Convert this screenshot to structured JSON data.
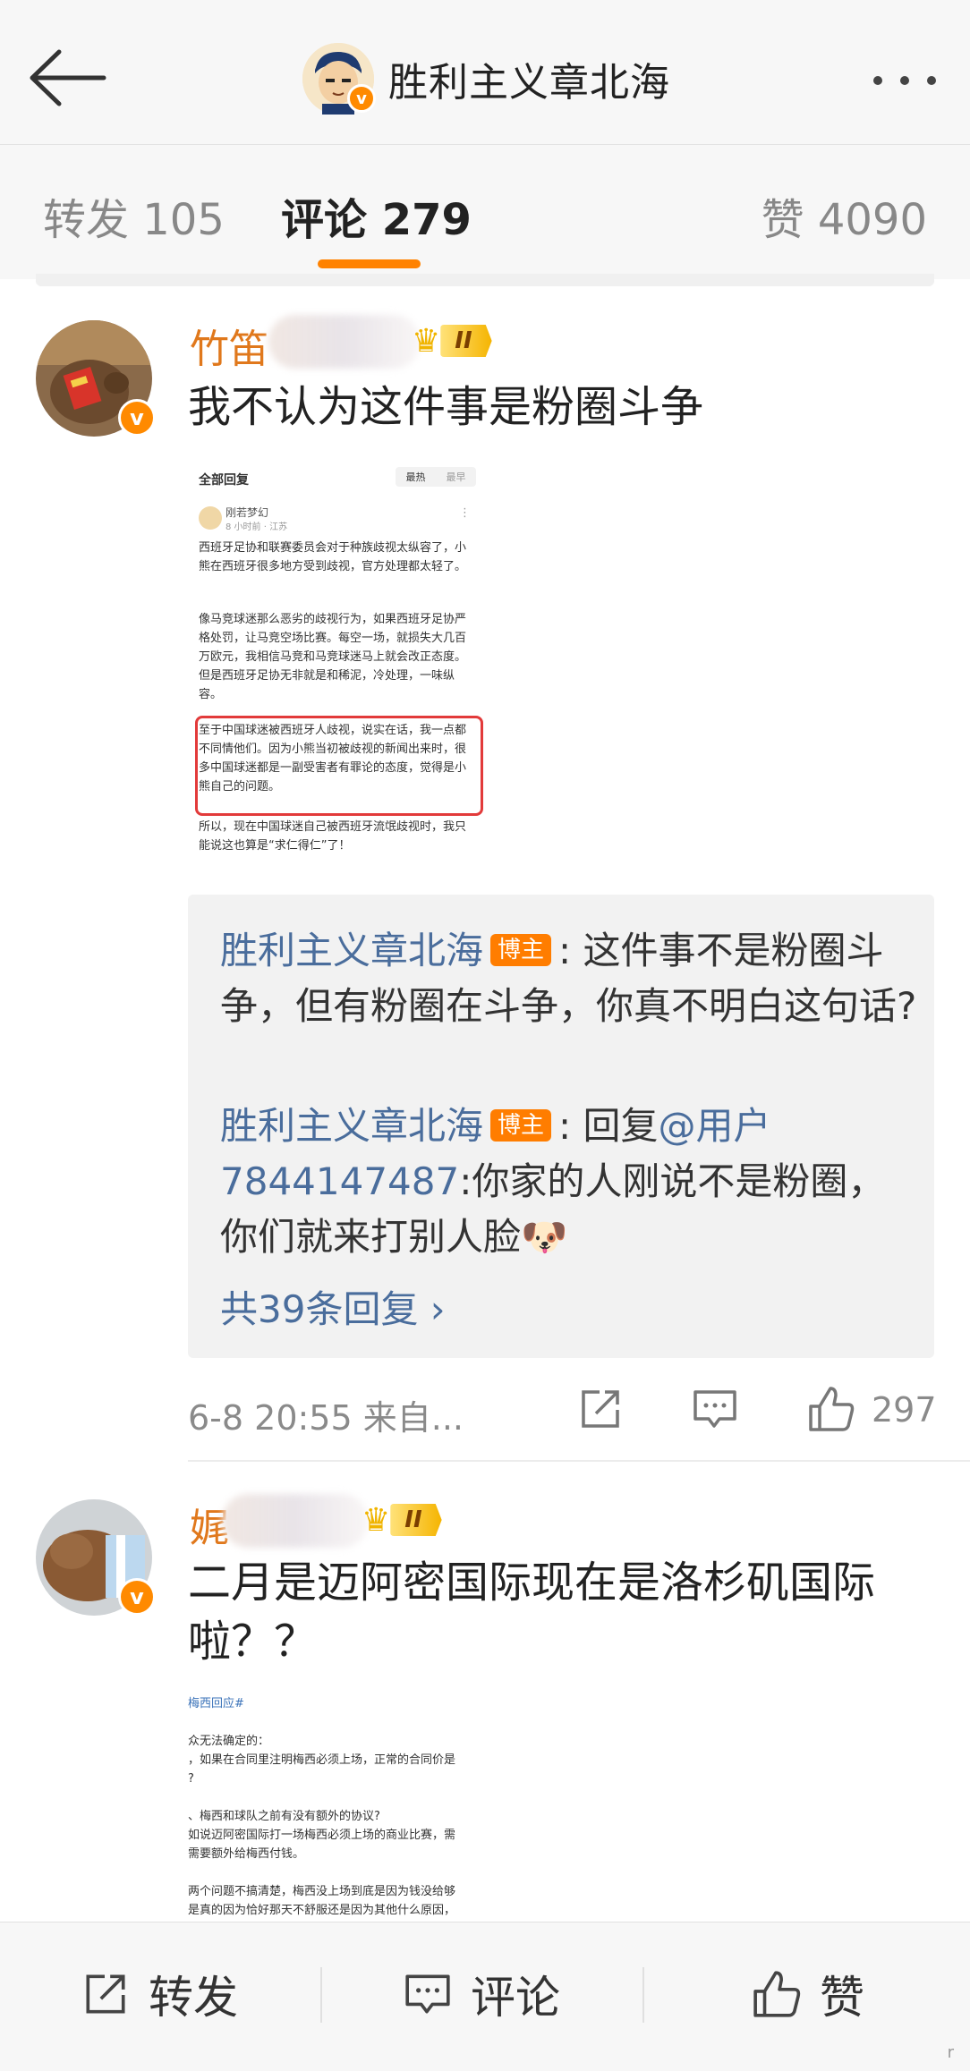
{
  "header": {
    "title": "胜利主义章北海",
    "verified": "v"
  },
  "tabs": {
    "repost": "转发 105",
    "comment": "评论 279",
    "like": "赞 4090"
  },
  "comments": [
    {
      "username": "竹笛",
      "level": "II",
      "text": "我不认为这件事是粉圈斗争",
      "screenshot": {
        "title": "全部回复",
        "tabs": [
          "最热",
          "最早"
        ],
        "user": "刚若梦幻",
        "time": "8 小时前 · 江苏",
        "para1": "西班牙足协和联赛委员会对于种族歧视太纵容了，小熊在西班牙很多地方受到歧视，官方处理都太轻了。",
        "para2": "像马竞球迷那么恶劣的歧视行为，如果西班牙足协严格处罚，让马竞空场比赛。每空一场，就损失大几百万欧元，我相信马竞和马竞球迷马上就会改正态度。但是西班牙足协无非就是和稀泥，冷处理，一味纵容。",
        "para3": "至于中国球迷被西班牙人歧视，说实在话，我一点都不同情他们。因为小熊当初被歧视的新闻出来时，很多中国球迷都是一副受害者有罪论的态度，觉得是小熊自己的问题。",
        "para4": "所以，现在中国球迷自己被西班牙流氓歧视时，我只能说这也算是“求仁得仁”了！"
      },
      "replies": [
        {
          "name": "胜利主义章北海",
          "badge": "博主",
          "text": ": 这件事不是粉圈斗争，但有粉圈在斗争，你真不明白这句话?"
        },
        {
          "name": "胜利主义章北海",
          "badge": "博主",
          "prefix": ": 回复",
          "mention": "@用户7844147487",
          "text": ":你家的人刚说不是粉圈，你们就来打别人脸",
          "emoji": "🐶"
        }
      ],
      "more_replies": "共39条回复 ›",
      "time": "6-8 20:55  来自...",
      "likes": "297"
    },
    {
      "username": "娓",
      "level": "II",
      "text": "二月是迈阿密国际现在是洛杉矶国际啦？？",
      "screenshot": {
        "hashtag": "梅西回应#",
        "l1": "众无法确定的：",
        "l2": "，如果在合同里注明梅西必须上场，正常的合同价是",
        "l3": "?",
        "l4": "、梅西和球队之前有没有额外的协议?",
        "l5": "如说迈阿密国际打一场梅西必须上场的商业比赛，需",
        "l6": "需要额外给梅西付钱。",
        "l7": "两个问题不搞清楚，梅西没上场到底是因为钱没给够",
        "l8": "是真的因为恰好那天不舒服还是因为其他什么原因，"
      }
    }
  ],
  "bottom_bar": {
    "repost": "转发",
    "comment": "评论",
    "like": "赞"
  },
  "watermark": "r"
}
